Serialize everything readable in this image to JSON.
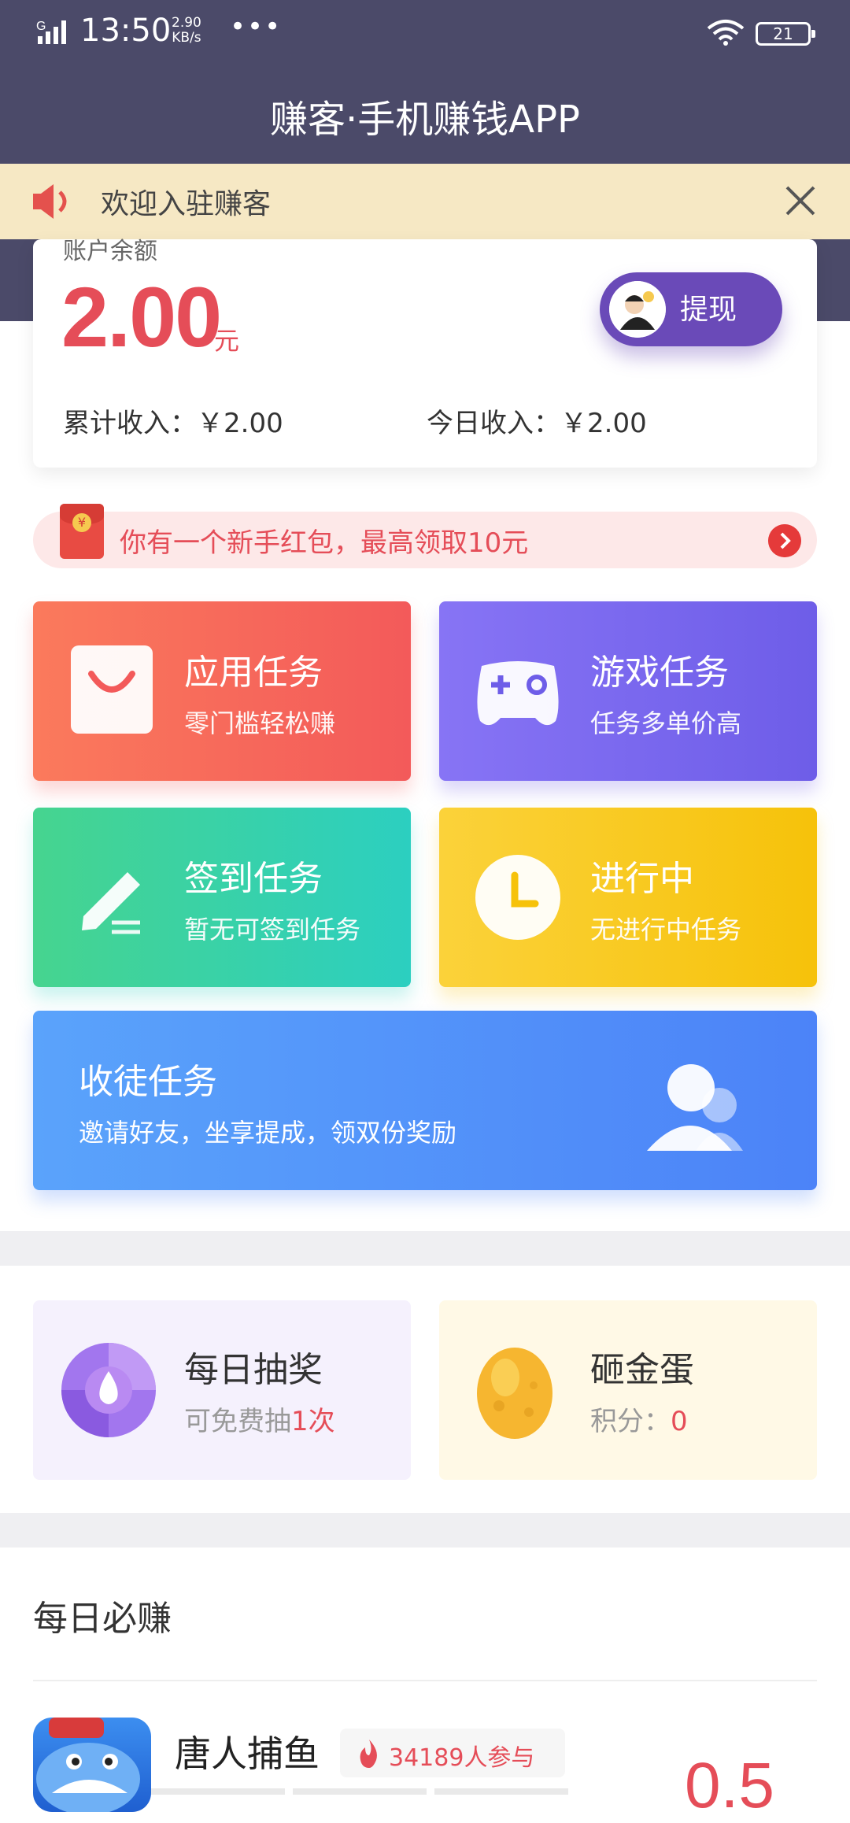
{
  "status_bar": {
    "network": "G",
    "time": "13:50",
    "speed": "2.90",
    "speed_unit": "KB/s",
    "dots": "•••",
    "battery": "21"
  },
  "header": {
    "title": "赚客·手机赚钱APP"
  },
  "notice": {
    "text": "欢迎入驻赚客"
  },
  "balance": {
    "label": "账户余额",
    "value": "2.00",
    "unit": "元",
    "withdraw_label": "提现",
    "total_income": "累计收入：￥2.00",
    "today_income": "今日收入：￥2.00"
  },
  "red_packet": {
    "text": "你有一个新手红包，最高领取10元",
    "yen": "¥"
  },
  "tasks": [
    {
      "title": "应用任务",
      "subtitle": "零门槛轻松赚"
    },
    {
      "title": "游戏任务",
      "subtitle": "任务多单价高"
    },
    {
      "title": "签到任务",
      "subtitle": "暂无可签到任务"
    },
    {
      "title": "进行中",
      "subtitle": "无进行中任务"
    }
  ],
  "invite": {
    "title": "收徒任务",
    "subtitle": "邀请好友，坐享提成，领双份奖励"
  },
  "lottery": {
    "title": "每日抽奖",
    "sub_prefix": "可免费抽",
    "sub_highlight": "1次"
  },
  "egg": {
    "title": "砸金蛋",
    "sub_prefix": "积分：",
    "sub_highlight": "0"
  },
  "daily": {
    "section_title": "每日必赚",
    "game_name": "唐人捕鱼",
    "participants": "34189",
    "participants_suffix": "人参与",
    "reward": "0.5"
  },
  "colors": {
    "header": "#4b4a69",
    "accent_red": "#e54d58",
    "withdraw_purple": "#6a4ab8"
  }
}
